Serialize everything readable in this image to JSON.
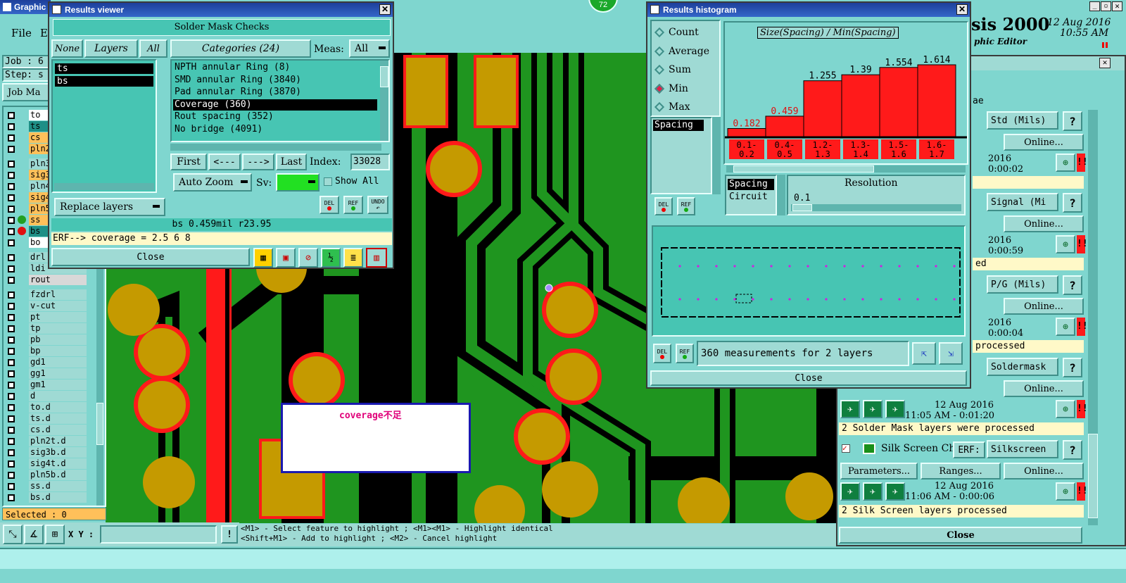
{
  "main": {
    "title": "Graphic",
    "menu": [
      "File",
      "Ed"
    ],
    "job_label": "Job : 6",
    "step_label": "Step: s",
    "job_matrix_label": "Job Ma",
    "layers": [
      {
        "name": "to",
        "color": "#ffffff"
      },
      {
        "name": "ts",
        "color": "#1e8f86"
      },
      {
        "name": "cs",
        "color": "#ffc05a"
      },
      {
        "name": "pln2",
        "color": "#ffc05a"
      },
      {
        "name": "pln3",
        "color": "#9fdad4"
      },
      {
        "name": "sig3",
        "color": "#ffc05a"
      },
      {
        "name": "pln4",
        "color": "#9fdad4"
      },
      {
        "name": "sig4",
        "color": "#ffc05a"
      },
      {
        "name": "pln5",
        "color": "#ffc05a"
      },
      {
        "name": "ss",
        "color": "#ffc05a"
      },
      {
        "name": "bs",
        "color": "#1e8f86"
      },
      {
        "name": "bo",
        "color": "#ffffff"
      },
      {
        "name": "drl",
        "color": "#9fdad4"
      },
      {
        "name": "ldi",
        "color": "#9fdad4"
      },
      {
        "name": "rout",
        "color": "#d8d8d8"
      },
      {
        "name": "fzdrl",
        "color": "#9fdad4"
      },
      {
        "name": "v-cut",
        "color": "#9fdad4"
      },
      {
        "name": "pt",
        "color": "#9fdad4"
      },
      {
        "name": "tp",
        "color": "#9fdad4"
      },
      {
        "name": "pb",
        "color": "#9fdad4"
      },
      {
        "name": "bp",
        "color": "#9fdad4"
      },
      {
        "name": "gd1",
        "color": "#9fdad4"
      },
      {
        "name": "gg1",
        "color": "#9fdad4"
      },
      {
        "name": "gm1",
        "color": "#9fdad4"
      },
      {
        "name": "d",
        "color": "#9fdad4"
      },
      {
        "name": "to.d",
        "color": "#9fdad4"
      },
      {
        "name": "ts.d",
        "color": "#9fdad4"
      },
      {
        "name": "cs.d",
        "color": "#9fdad4"
      },
      {
        "name": "pln2t.d",
        "color": "#9fdad4"
      },
      {
        "name": "sig3b.d",
        "color": "#9fdad4"
      },
      {
        "name": "sig4t.d",
        "color": "#9fdad4"
      },
      {
        "name": "pln5b.d",
        "color": "#9fdad4"
      },
      {
        "name": "ss.d",
        "color": "#9fdad4"
      },
      {
        "name": "bs.d",
        "color": "#9fdad4"
      }
    ],
    "selected_label": "Selected : 0",
    "xy_label": "X Y :",
    "hint_line1": "<M1> - Select feature to highlight ; <M1><M1> - Highlight identical",
    "hint_line2": "<Shift+M1> - Add to highlight ; <M2> - Cancel highlight",
    "badge_count": "72",
    "annotation": "coverage不足"
  },
  "brand": {
    "title": "sis 2000",
    "subtitle": "phic Editor",
    "date": "12 Aug 2016",
    "time": "10:55 AM"
  },
  "results_viewer": {
    "title": "Results viewer",
    "header": "Solder Mask Checks",
    "btn_none": "None",
    "btn_layers": "Layers",
    "btn_all": "All",
    "layer_items": [
      "ts",
      "bs"
    ],
    "categories_label": "Categories (24)",
    "meas_label": "Meas:",
    "meas_value": "All",
    "categories": [
      "NPTH annular Ring (8)",
      "SMD annular Ring (3840)",
      "Pad annular Ring (3870)",
      "Coverage (360)",
      "Rout spacing (352)",
      "No bridge (4091)"
    ],
    "selected_category": "Coverage (360)",
    "nav_first": "First",
    "nav_prev": "<---",
    "nav_next": "--->",
    "nav_last": "Last",
    "index_label": "Index:",
    "index_value": "33028",
    "auto_zoom": "Auto Zoom",
    "sv_label": "Sv:",
    "show_all": "Show All",
    "replace_layers": "Replace layers",
    "del": "DEL",
    "ref": "REF",
    "undo": "UNDO",
    "status": "bs 0.459mil  r23.95",
    "erf_line": "ERF--> coverage = 2.5 6 8",
    "close": "Close"
  },
  "histogram": {
    "title": "Results histogram",
    "modes": [
      "Count",
      "Average",
      "Sum",
      "Min",
      "Max"
    ],
    "selected_mode": "Min",
    "list_item": "Spacing",
    "chart_title": "Size(Spacing) / Min(Spacing)",
    "spacing_item": "Spacing",
    "circuit_item": "Circuit",
    "resolution_label": "Resolution",
    "resolution_value": "0.1",
    "del": "DEL",
    "ref": "REF",
    "measurements": "360 measurements for 2 layers",
    "close": "Close"
  },
  "chart_data": {
    "type": "bar",
    "title": "Size(Spacing) / Min(Spacing)",
    "categories": [
      "0.1-0.2",
      "0.4-0.5",
      "1.2-1.3",
      "1.3-1.4",
      "1.5-1.6",
      "1.6-1.7"
    ],
    "values": [
      0.182,
      0.459,
      1.255,
      1.39,
      1.554,
      1.614
    ],
    "value_labels": [
      "0.182",
      "0.459",
      "1.255",
      "1.39",
      "1.554",
      "1.614"
    ],
    "colors": {
      "bar": "#ff1a1a",
      "label_low": "#e01010",
      "label_high": "#000000"
    }
  },
  "erf_panel": {
    "title_fragment": "ae",
    "rows": [
      {
        "combo": "Std (Mils)",
        "online": "Online...",
        "date": "2016",
        "duration": "0:00:02",
        "status": ""
      },
      {
        "combo": "Signal (Mi",
        "online": "Online...",
        "date": "2016",
        "duration": "0:00:59",
        "status": "ed"
      },
      {
        "combo": "P/G (Mils)",
        "online": "Online...",
        "date": "2016",
        "duration": "0:00:04",
        "status": "processed"
      },
      {
        "combo": "Soldermask",
        "online": "Online...",
        "date": "12 Aug 2016",
        "duration": "11:05 AM - 0:01:20",
        "status": "2 Solder Mask layers were processed"
      }
    ],
    "silk": {
      "name": "Silk Screen Che",
      "erf": "ERF:",
      "combo": "Silkscreen",
      "parameters": "Parameters...",
      "ranges": "Ranges...",
      "online": "Online...",
      "date": "12 Aug 2016",
      "duration": "11:06 AM - 0:00:06",
      "status": "2 Silk Screen layers processed"
    },
    "close": "Close"
  }
}
